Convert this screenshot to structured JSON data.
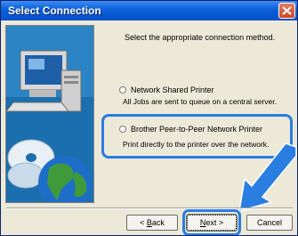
{
  "window": {
    "title": "Select Connection"
  },
  "content": {
    "heading": "Select the appropriate connection method.",
    "options": [
      {
        "label": "Network Shared Printer",
        "description": "All Jobs are sent to queue on a central server."
      },
      {
        "label": "Brother Peer-to-Peer Network Printer",
        "description": "Print directly to the printer over the network."
      }
    ]
  },
  "buttons": {
    "back_prefix": "< ",
    "back_key": "B",
    "back_rest": "ack",
    "next_key": "N",
    "next_rest": "ext >",
    "cancel": "Cancel"
  },
  "colors": {
    "highlight": "#2a7de1",
    "titlebar": "#0a5fd8"
  }
}
